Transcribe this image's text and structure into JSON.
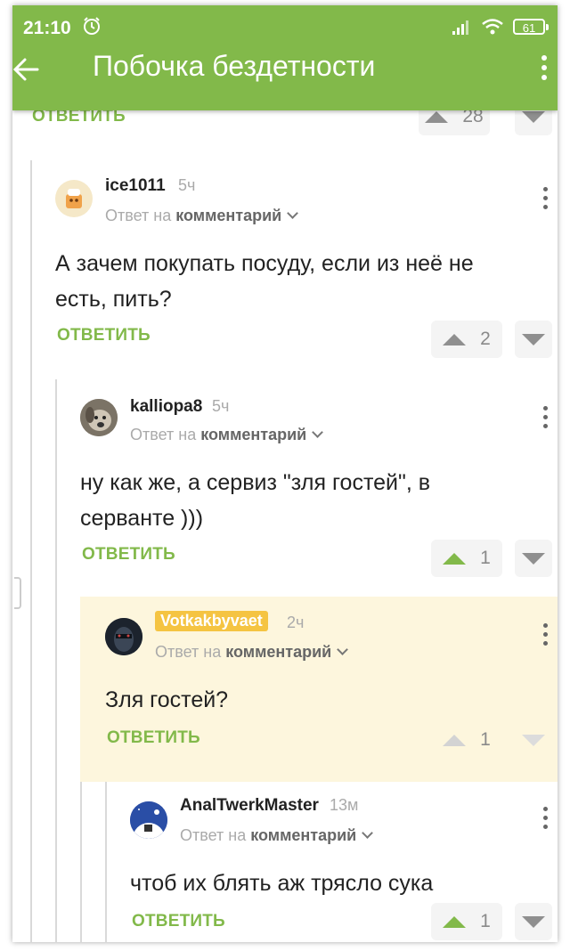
{
  "status_bar": {
    "time": "21:10",
    "battery": "61"
  },
  "header": {
    "title": "Побочка бездетности"
  },
  "colors": {
    "brand": "#82b94a",
    "highlight": "#fdf6dd",
    "author_badge": "#f5c442"
  },
  "top_partial": {
    "reply_label": "ОТВЕТИТЬ",
    "rating": "28"
  },
  "comments": [
    {
      "username": "ice1011",
      "time": "5ч",
      "reply_prefix": "Ответ на",
      "reply_target": "комментарий",
      "lines": [
        "А зачем покупать посуду, если из неё не",
        "есть, пить?"
      ],
      "reply_label": "ОТВЕТИТЬ",
      "rating": "2",
      "avatar_icon": "cartoon-avatar"
    },
    {
      "username": "kalliopa8",
      "time": "5ч",
      "reply_prefix": "Ответ на",
      "reply_target": "комментарий",
      "lines": [
        "ну как же, а сервиз \"зля гостей\", в",
        "серванте )))"
      ],
      "reply_label": "ОТВЕТИТЬ",
      "rating": "1",
      "avatar_icon": "dog-avatar"
    },
    {
      "username": "Votkakbyvaet",
      "time": "2ч",
      "reply_prefix": "Ответ на",
      "reply_target": "комментарий",
      "lines": [
        "Зля гостей?"
      ],
      "reply_label": "ОТВЕТИТЬ",
      "rating": "1",
      "avatar_icon": "dark-face-avatar"
    },
    {
      "username": "AnalTwerkMaster",
      "time": "13м",
      "reply_prefix": "Ответ на",
      "reply_target": "комментарий",
      "lines": [
        "чтоб их блять аж трясло сука"
      ],
      "reply_label": "ОТВЕТИТЬ",
      "rating": "1",
      "avatar_icon": "night-sky-avatar"
    }
  ]
}
